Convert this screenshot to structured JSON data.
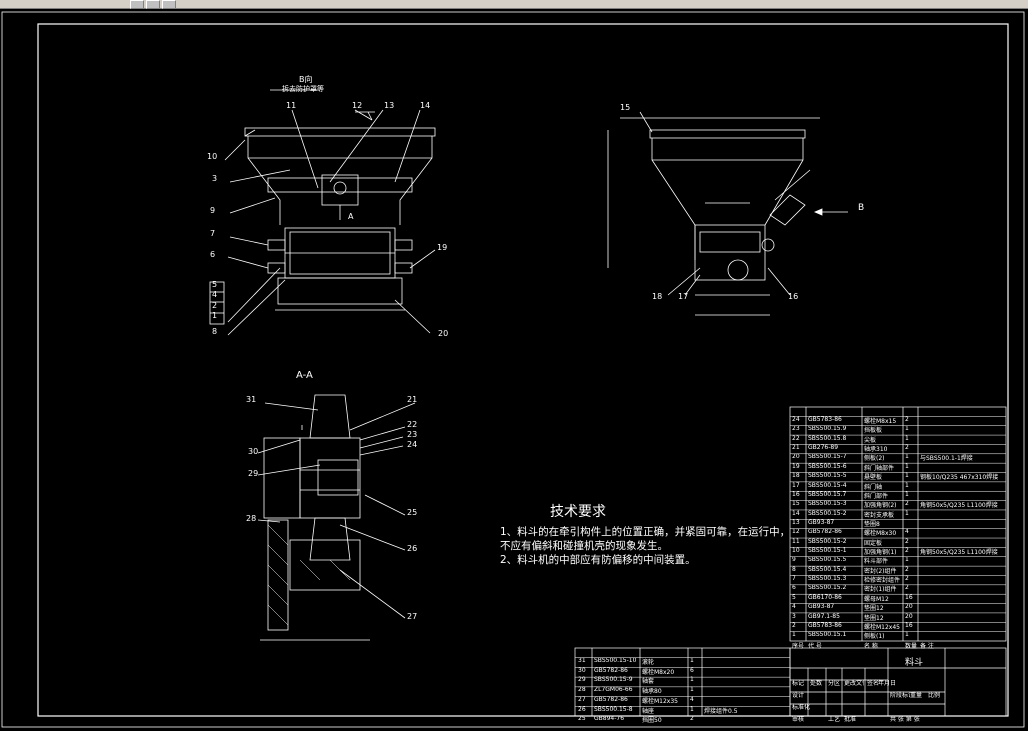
{
  "notes": {
    "title": "技术要求",
    "lines": [
      "1、料斗的在牵引构件上的位置正确，并紧固可靠，在运行中，",
      "不应有偏斜和碰撞机壳的现象发生。",
      "2、料斗机的中部应有防偏移的中间装置。"
    ]
  },
  "views": {
    "view_b_title": "B向",
    "view_b_sub": "拆去防护罩等",
    "section_aa": "A-A",
    "arrow_b": "B",
    "arrow_a": "A"
  },
  "balloons": {
    "front": [
      "1",
      "2",
      "3",
      "4",
      "5",
      "6",
      "7",
      "8",
      "9",
      "10",
      "11",
      "12",
      "13",
      "14",
      "19",
      "20"
    ],
    "side": [
      "15",
      "16",
      "17",
      "18"
    ],
    "section": [
      "21",
      "22",
      "23",
      "24",
      "25",
      "26",
      "27",
      "28",
      "29",
      "30",
      "31"
    ]
  },
  "bom_upper": [
    [
      "24",
      "GB5783-86",
      "螺栓M8x15",
      "2",
      ""
    ],
    [
      "23",
      "SBS500.15.9",
      "挡板板",
      "1",
      ""
    ],
    [
      "22",
      "SBS500.15.8",
      "尖板",
      "1",
      ""
    ],
    [
      "21",
      "GB276-89",
      "轴承310",
      "2",
      ""
    ],
    [
      "20",
      "SBS500.15-7",
      "侧板(2)",
      "1",
      "与SBS500.1-1焊接"
    ],
    [
      "19",
      "SBS500.15-6",
      "斜门轴部件",
      "1",
      ""
    ],
    [
      "18",
      "SBS500.15-5",
      "悬壁板",
      "1",
      "钢板10/Q235 467x310焊接"
    ],
    [
      "17",
      "SBS500.15-4",
      "斜门轴",
      "1",
      ""
    ],
    [
      "16",
      "SBS500.15.7",
      "斜门部件",
      "1",
      ""
    ],
    [
      "15",
      "SBS500.15-3",
      "加强角钢(2)",
      "2",
      "角钢50x5/Q235 L1100焊接"
    ],
    [
      "14",
      "SBS500.15-2",
      "密封支承板",
      "1",
      ""
    ],
    [
      "13",
      "GB93-87",
      "垫圈8",
      "",
      ""
    ],
    [
      "12",
      "GB5782-86",
      "螺栓M8x30",
      "4",
      ""
    ],
    [
      "11",
      "SBS500.15-2",
      "固定板",
      "2",
      ""
    ],
    [
      "10",
      "SBS500.15-1",
      "加强角钢(1)",
      "2",
      "角钢50x5/Q235 L1100焊接"
    ],
    [
      "9",
      "SBS500.15.5",
      "料斗部件",
      "1",
      ""
    ],
    [
      "8",
      "SBS500.15.4",
      "密封(2)组件",
      "2",
      ""
    ],
    [
      "7",
      "SBS500.15.3",
      "检修密封组件",
      "2",
      ""
    ],
    [
      "6",
      "SBS500.15.2",
      "密封(1)组件",
      "2",
      ""
    ],
    [
      "5",
      "GB6170-86",
      "螺母M12",
      "16",
      ""
    ],
    [
      "4",
      "GB93-87",
      "垫圈12",
      "20",
      ""
    ],
    [
      "3",
      "GB97.1-85",
      "垫圈12",
      "20",
      ""
    ],
    [
      "2",
      "GB5783-86",
      "螺栓M12x45",
      "16",
      ""
    ],
    [
      "1",
      "SBS500.15.1",
      "侧板(1)",
      "1",
      ""
    ]
  ],
  "bom_upper_header": [
    "序号",
    "代 号",
    "名 称",
    "数量",
    "备 注"
  ],
  "bom_lower": [
    [
      "31",
      "SBS500.15-10",
      "滚轮",
      "1",
      ""
    ],
    [
      "30",
      "GB5782-86",
      "螺栓M8x20",
      "6",
      ""
    ],
    [
      "29",
      "SBS500.15-9",
      "轴套",
      "1",
      ""
    ],
    [
      "28",
      "ZL7GM06-66",
      "轴承80",
      "1",
      ""
    ],
    [
      "27",
      "GB5782-86",
      "螺栓M12x35",
      "4",
      ""
    ],
    [
      "26",
      "SBS500.15-8",
      "轴座",
      "1",
      "焊接组件0.5"
    ],
    [
      "25",
      "GB894-76",
      "挡圈50",
      "2",
      ""
    ]
  ],
  "title_block": {
    "name": "料斗",
    "cells": [
      "标记",
      "处数",
      "分区",
      "更改文件号",
      "签名",
      "年月日",
      "设计",
      "标准化",
      "审核",
      "工艺",
      "批准",
      "阶段标记",
      "重量",
      "比例",
      "共 张 第 张"
    ]
  }
}
